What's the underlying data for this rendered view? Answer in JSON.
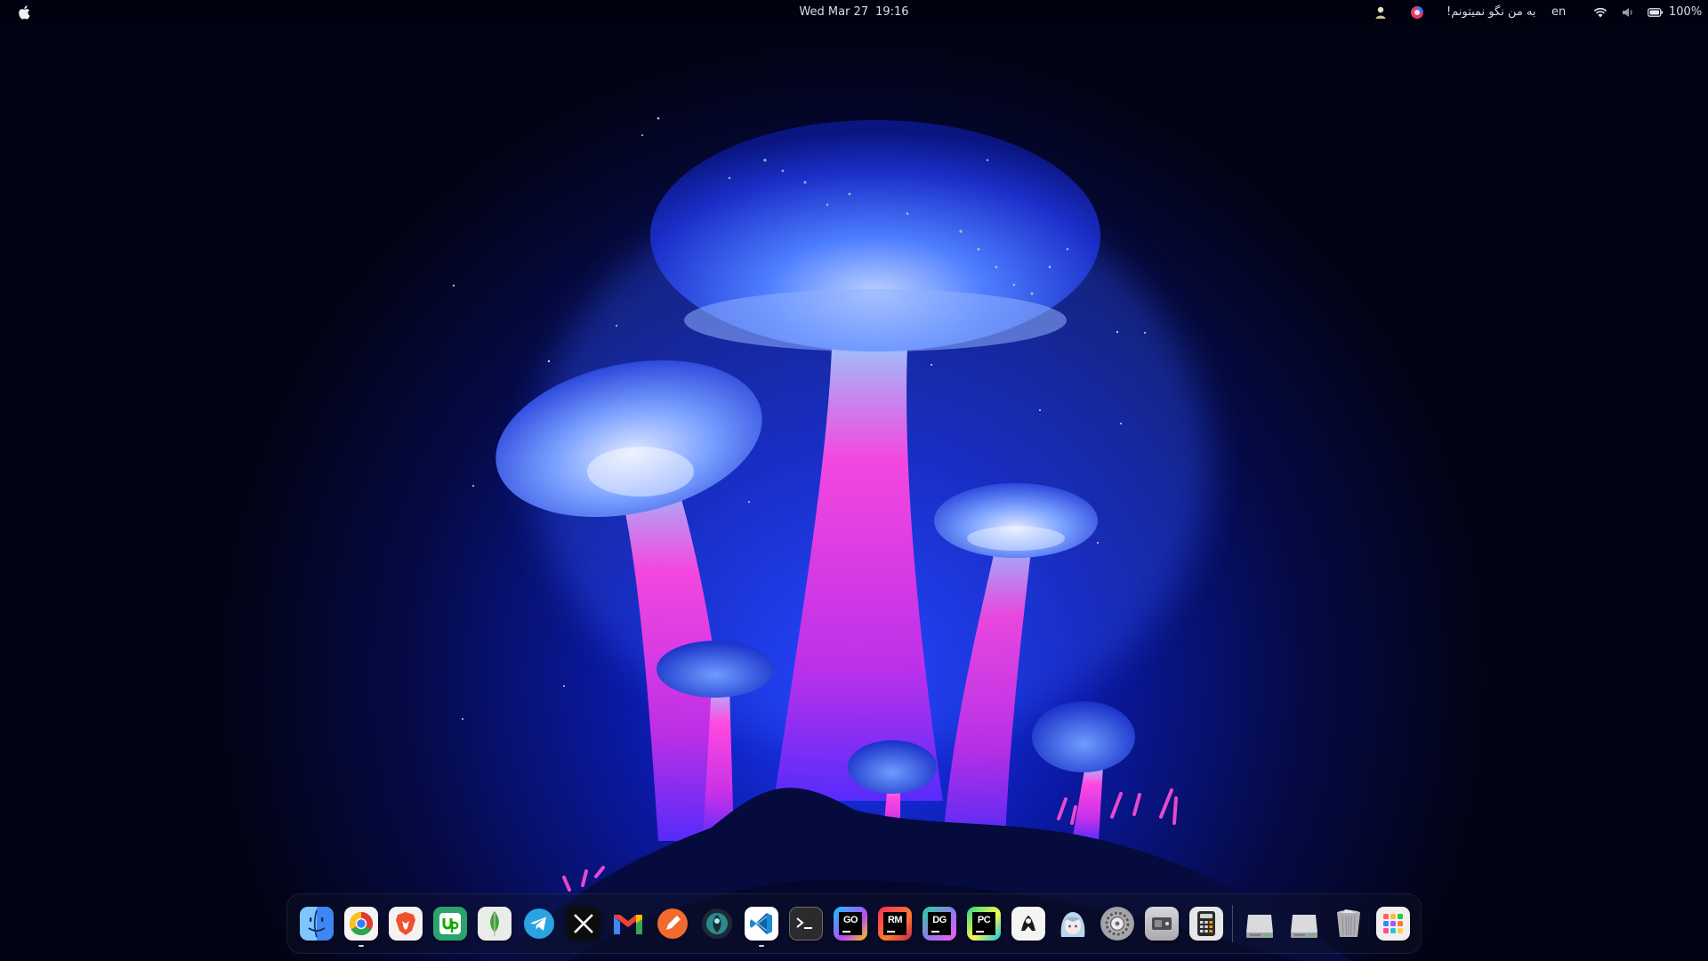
{
  "topbar": {
    "clock_date": "Wed Mar 27",
    "clock_time": "19:16",
    "status_message": "به من نگو نمیتونم!",
    "language": "en",
    "battery_percent": "100%"
  },
  "dock": {
    "items": [
      {
        "name": "Finder",
        "icon": "finder-icon",
        "running": false
      },
      {
        "name": "Google Chrome",
        "icon": "chrome-icon",
        "running": true
      },
      {
        "name": "Brave Browser",
        "icon": "brave-icon",
        "running": false
      },
      {
        "name": "Upwork",
        "icon": "upwork-icon",
        "running": false
      },
      {
        "name": "MongoDB Compass",
        "icon": "mongodb-icon",
        "running": false
      },
      {
        "name": "Telegram",
        "icon": "telegram-icon",
        "running": false
      },
      {
        "name": "X",
        "icon": "x-icon",
        "running": false
      },
      {
        "name": "Gmail",
        "icon": "gmail-icon",
        "running": false
      },
      {
        "name": "Pen app",
        "icon": "pen-icon",
        "running": false
      },
      {
        "name": "Browser",
        "icon": "globe-icon",
        "running": false
      },
      {
        "name": "Visual Studio Code",
        "icon": "vscode-icon",
        "running": true
      },
      {
        "name": "Terminal",
        "icon": "terminal-icon",
        "running": false
      },
      {
        "name": "GoLand",
        "icon": "goland-icon",
        "label": "GO",
        "running": false
      },
      {
        "name": "RubyMine",
        "icon": "rubymine-icon",
        "label": "RM",
        "running": false
      },
      {
        "name": "DataGrip",
        "icon": "datagrip-icon",
        "label": "DG",
        "running": false
      },
      {
        "name": "PyCharm",
        "icon": "pycharm-icon",
        "label": "PC",
        "running": false
      },
      {
        "name": "Postman",
        "icon": "postman-icon",
        "running": false
      },
      {
        "name": "Anime app",
        "icon": "anime-avatar-icon",
        "running": false
      },
      {
        "name": "System Settings",
        "icon": "settings-icon",
        "running": false
      },
      {
        "name": "Screen Recorder",
        "icon": "screen-recorder-icon",
        "running": false
      },
      {
        "name": "Calculator",
        "icon": "calculator-icon",
        "running": false
      },
      {
        "name": "Drive 1",
        "icon": "drive-icon",
        "running": false
      },
      {
        "name": "Drive 2",
        "icon": "drive-icon",
        "running": false
      },
      {
        "name": "Trash",
        "icon": "trash-icon",
        "running": false
      },
      {
        "name": "Launchpad",
        "icon": "launchpad-icon",
        "running": false
      }
    ]
  },
  "colors": {
    "background_dark": "#020313",
    "glow_blue": "#1a4dff",
    "mushroom_pink": "#ff3fd8",
    "cap_blue": "#4a7bff"
  }
}
